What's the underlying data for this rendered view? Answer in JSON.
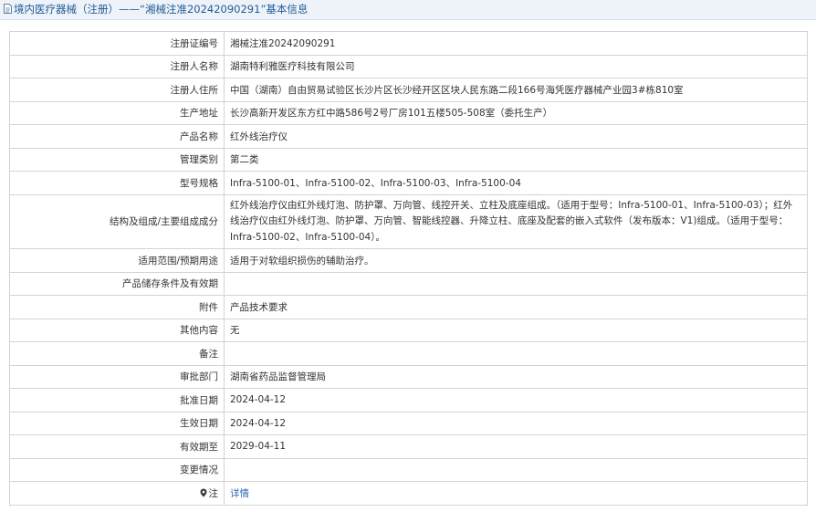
{
  "header": {
    "title": "境内医疗器械（注册）——“湘械注准20242090291”基本信息",
    "icon": "document-icon"
  },
  "rows": [
    {
      "label": "注册证编号",
      "value": "湘械注准20242090291"
    },
    {
      "label": "注册人名称",
      "value": "湖南特利雅医疗科技有限公司"
    },
    {
      "label": "注册人住所",
      "value": "中国（湖南）自由贸易试验区长沙片区长沙经开区区块人民东路二段166号海凭医疗器械产业园3#栋810室"
    },
    {
      "label": "生产地址",
      "value": "长沙高新开发区东方红中路586号2号厂房101五楼505-508室（委托生产）"
    },
    {
      "label": "产品名称",
      "value": "红外线治疗仪"
    },
    {
      "label": "管理类别",
      "value": "第二类"
    },
    {
      "label": "型号规格",
      "value": "Infra-5100-01、Infra-5100-02、Infra-5100-03、Infra-5100-04"
    },
    {
      "label": "结构及组成/主要组成成分",
      "value": "红外线治疗仪由红外线灯泡、防护罩、万向管、线控开关、立柱及底座组成。（适用于型号：Infra-5100-01、Infra-5100-03）；红外线治疗仪由红外线灯泡、防护罩、万向管、智能线控器、升降立柱、底座及配套的嵌入式软件（发布版本：V1)组成。（适用于型号：Infra-5100-02、Infra-5100-04）。"
    },
    {
      "label": "适用范围/预期用途",
      "value": "适用于对软组织损伤的辅助治疗。"
    },
    {
      "label": "产品储存条件及有效期",
      "value": ""
    },
    {
      "label": "附件",
      "value": "产品技术要求"
    },
    {
      "label": "其他内容",
      "value": "无"
    },
    {
      "label": "备注",
      "value": ""
    },
    {
      "label": "审批部门",
      "value": "湖南省药品监督管理局"
    },
    {
      "label": "批准日期",
      "value": "2024-04-12"
    },
    {
      "label": "生效日期",
      "value": "2024-04-12"
    },
    {
      "label": "有效期至",
      "value": "2029-04-11"
    },
    {
      "label": "变更情况",
      "value": ""
    }
  ],
  "note": {
    "label": "注",
    "icon": "info-bullet-icon",
    "link_text": "详情"
  },
  "colors": {
    "title_text": "#1f5a96",
    "title_bar_bg": "#eef3f9",
    "border": "#d3d3d3",
    "link": "#2a6ab8"
  }
}
